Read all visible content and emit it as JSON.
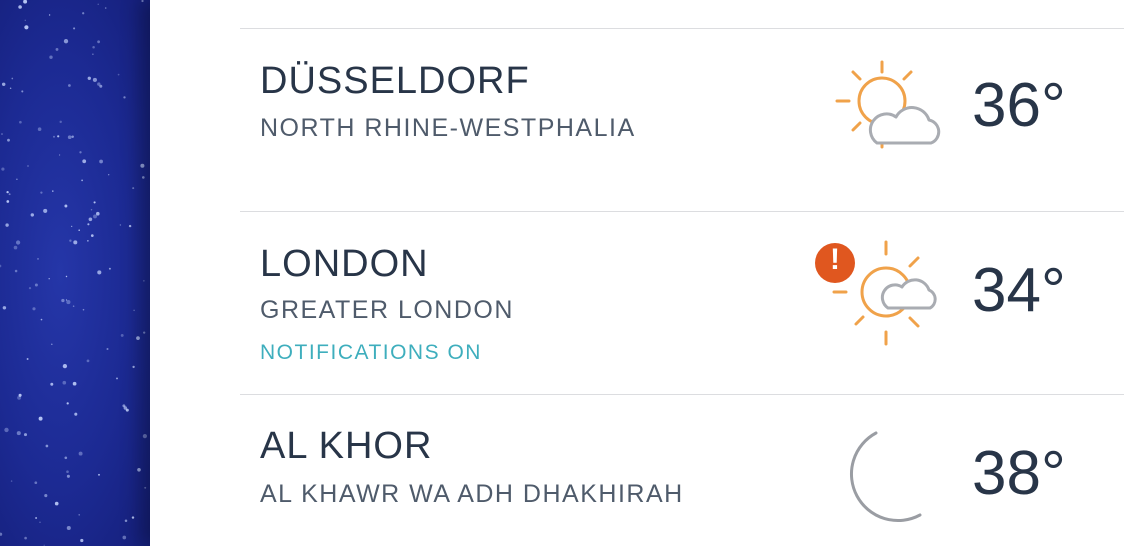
{
  "locations": [
    {
      "city": "DÜSSELDORF",
      "region": "NORTH RHINE-WESTPHALIA",
      "notification": "",
      "temperature": "36°",
      "icon": "partly-sunny-icon",
      "alert": false
    },
    {
      "city": "LONDON",
      "region": "GREATER LONDON",
      "notification": "NOTIFICATIONS ON",
      "temperature": "34°",
      "icon": "partly-sunny-icon",
      "alert": true,
      "alert_glyph": "!"
    },
    {
      "city": "AL KHOR",
      "region": "AL KHAWR WA ADH DHAKHIRAH",
      "notification": "",
      "temperature": "38°",
      "icon": "moon-icon",
      "alert": false
    }
  ],
  "colors": {
    "sun": "#f0a24a",
    "cloud": "#a9acb2",
    "moon": "#9a9da3",
    "alert": "#e0571f",
    "notification": "#3eaebd",
    "text_primary": "#283548",
    "text_secondary": "#4f5b6b",
    "background_sidebar": "#1c2a93"
  }
}
